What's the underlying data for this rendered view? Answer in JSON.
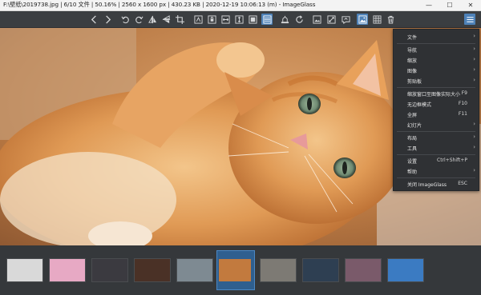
{
  "window": {
    "title": "F:\\壁纸\\2019738.jpg  |  6/10 文件  |  50.16%  |  2560 x 1600 px  |  430.23 KB  |  2020-12-19 10:06:13 (m)  - ImageGlass",
    "controls": [
      "—",
      "☐",
      "✕"
    ]
  },
  "toolbar": {
    "icons": [
      "previous-icon",
      "next-icon",
      "rotate-left-icon",
      "rotate-right-icon",
      "flip-horizontal-icon",
      "flip-vertical-icon",
      "crop-icon",
      "zoom-auto-icon",
      "zoom-lock-icon",
      "scale-width-icon",
      "scale-height-icon",
      "scale-fit-icon",
      "scale-fill-icon",
      "wallpaper-icon",
      "refresh-icon",
      "slideshow-icon",
      "fullscreen-icon",
      "edit-icon",
      "gallery-icon",
      "grid-icon",
      "delete-icon",
      "menu-icon"
    ]
  },
  "menu": {
    "items": [
      {
        "label": "文件",
        "shortcut": "",
        "submenu": true
      },
      {
        "label": "导航",
        "shortcut": "",
        "submenu": true
      },
      {
        "label": "缩放",
        "shortcut": "",
        "submenu": true
      },
      {
        "label": "图像",
        "shortcut": "",
        "submenu": true
      },
      {
        "label": "剪贴板",
        "shortcut": "",
        "submenu": true
      },
      {
        "label": "缩放窗口至图像实际大小",
        "shortcut": "F9",
        "submenu": false
      },
      {
        "label": "无边框模式",
        "shortcut": "F10",
        "submenu": false
      },
      {
        "label": "全屏",
        "shortcut": "F11",
        "submenu": false
      },
      {
        "label": "幻灯片",
        "shortcut": "",
        "submenu": true
      },
      {
        "label": "布局",
        "shortcut": "",
        "submenu": true
      },
      {
        "label": "工具",
        "shortcut": "",
        "submenu": true
      },
      {
        "label": "设置",
        "shortcut": "Ctrl+Shift+P",
        "submenu": false
      },
      {
        "label": "帮助",
        "shortcut": "",
        "submenu": true
      },
      {
        "label": "关闭 ImageGlass",
        "shortcut": "ESC",
        "submenu": false
      }
    ]
  },
  "thumbnails": {
    "selected_index": 5,
    "items": [
      {
        "name": "thumb-1",
        "color": "#d9d9d9"
      },
      {
        "name": "thumb-2",
        "color": "#e7a9c4"
      },
      {
        "name": "thumb-3",
        "color": "#3b3a40"
      },
      {
        "name": "thumb-4",
        "color": "#4a3126"
      },
      {
        "name": "thumb-5",
        "color": "#7e8a92"
      },
      {
        "name": "thumb-6",
        "color": "#c27a3e"
      },
      {
        "name": "thumb-7",
        "color": "#7d7a74"
      },
      {
        "name": "thumb-8",
        "color": "#2e3f52"
      },
      {
        "name": "thumb-9",
        "color": "#7a5a6a"
      },
      {
        "name": "thumb-10",
        "color": "#3b7bc2"
      }
    ]
  },
  "colors": {
    "accent": "#4e82b8",
    "toolbar_bg": "#3b3e41",
    "menu_bg": "#2f3134"
  }
}
